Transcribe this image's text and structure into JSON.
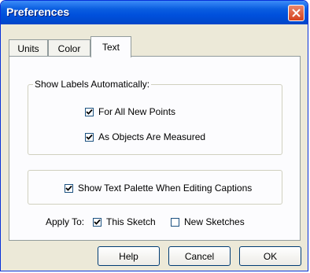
{
  "window": {
    "title": "Preferences"
  },
  "tabs": [
    {
      "label": "Units"
    },
    {
      "label": "Color"
    },
    {
      "label": "Text"
    }
  ],
  "show_labels": {
    "legend": "Show Labels Automatically:",
    "for_all_new_points": {
      "label": "For All New Points",
      "checked": true
    },
    "as_objects_measured": {
      "label": "As Objects Are Measured",
      "checked": true
    }
  },
  "text_palette": {
    "label": "Show Text Palette When Editing Captions",
    "checked": true
  },
  "apply_to": {
    "label": "Apply To:",
    "this_sketch": {
      "label": "This Sketch",
      "checked": true
    },
    "new_sketches": {
      "label": "New Sketches",
      "checked": false
    }
  },
  "buttons": {
    "help": "Help",
    "cancel": "Cancel",
    "ok": "OK"
  }
}
